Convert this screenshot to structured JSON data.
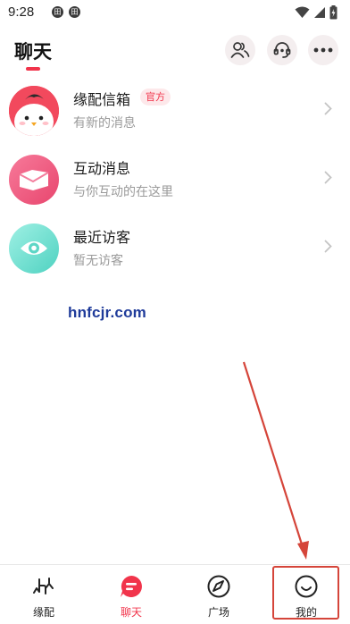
{
  "status_bar": {
    "time": "9:28",
    "notifications": [
      "田",
      "田"
    ],
    "icons": [
      "wifi-icon",
      "signal-icon",
      "battery-icon"
    ]
  },
  "header": {
    "title": "聊天",
    "accent_color": "#f1344b",
    "actions": [
      "contacts-icon",
      "support-icon",
      "more-icon"
    ]
  },
  "list": [
    {
      "title": "缘配信箱",
      "badge": "官方",
      "subtitle": "有新的消息",
      "icon": "chick-avatar"
    },
    {
      "title": "互动消息",
      "subtitle": "与你互动的在这里",
      "icon": "envelope-icon"
    },
    {
      "title": "最近访客",
      "subtitle": "暂无访客",
      "icon": "eye-icon"
    }
  ],
  "watermark": "hnfcjr.com",
  "bottom_nav": {
    "active_index": 1,
    "items": [
      {
        "label": "缘配",
        "icon": "match-icon"
      },
      {
        "label": "聊天",
        "icon": "chat-icon"
      },
      {
        "label": "广场",
        "icon": "compass-icon"
      },
      {
        "label": "我的",
        "icon": "smile-icon"
      }
    ]
  },
  "annotation": {
    "color": "#d5453a",
    "target": "bottom_nav.items.3"
  }
}
